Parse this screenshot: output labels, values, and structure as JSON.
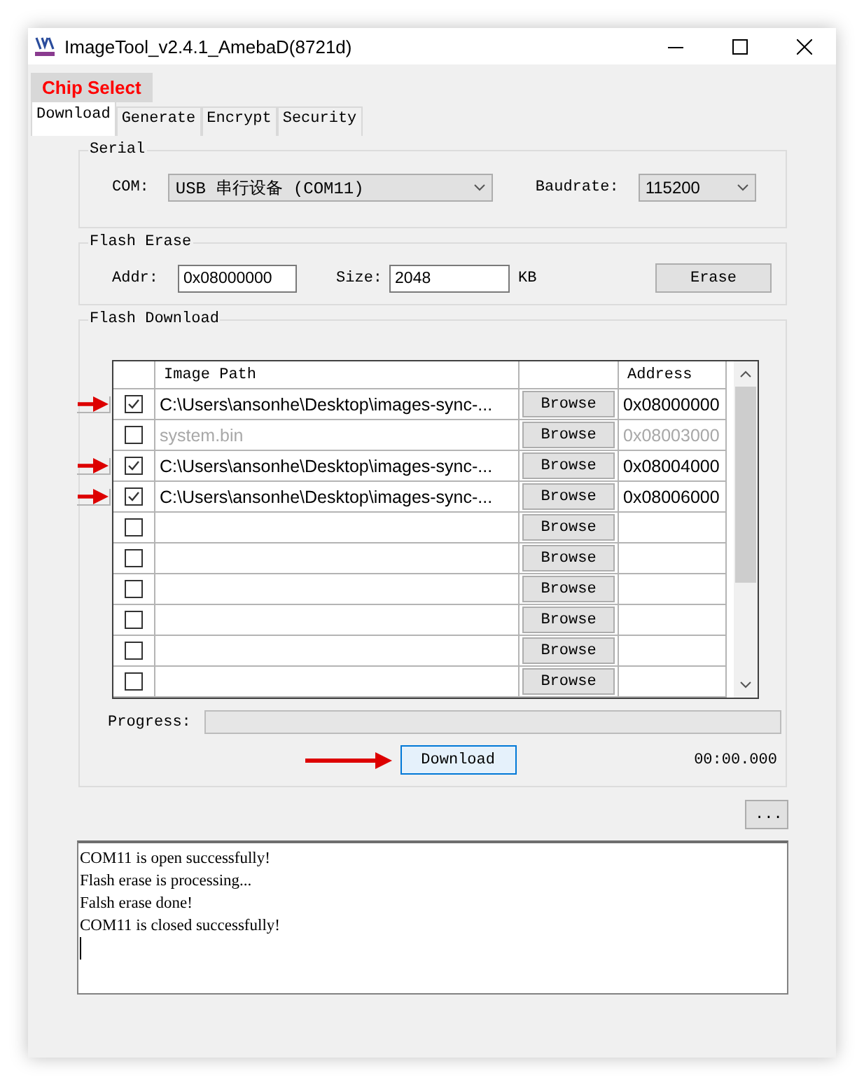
{
  "window": {
    "title": "ImageTool_v2.4.1_AmebaD(8721d)"
  },
  "chip_select": {
    "label": "Chip Select"
  },
  "tabs": [
    {
      "label": "Download",
      "selected": true
    },
    {
      "label": "Generate",
      "selected": false
    },
    {
      "label": "Encrypt",
      "selected": false
    },
    {
      "label": "Security",
      "selected": false
    }
  ],
  "serial": {
    "title": "Serial",
    "com_label": "COM:",
    "com_value": "USB 串行设备 (COM11)",
    "baud_label": "Baudrate:",
    "baud_value": "115200"
  },
  "flash_erase": {
    "title": "Flash Erase",
    "addr_label": "Addr:",
    "addr_value": "0x08000000",
    "size_label": "Size:",
    "size_value": "2048",
    "unit": "KB",
    "button": "Erase"
  },
  "flash_download": {
    "title": "Flash Download",
    "table": {
      "columns": [
        "Image Path",
        "Address"
      ],
      "rows": [
        {
          "checked": true,
          "disabled": false,
          "marked": true,
          "path": "C:\\Users\\ansonhe\\Desktop\\images-sync-...",
          "button": "Browse",
          "address": "0x08000000"
        },
        {
          "checked": false,
          "disabled": true,
          "marked": false,
          "path": "system.bin",
          "button": "Browse",
          "address": "0x08003000"
        },
        {
          "checked": true,
          "disabled": false,
          "marked": true,
          "path": "C:\\Users\\ansonhe\\Desktop\\images-sync-...",
          "button": "Browse",
          "address": "0x08004000"
        },
        {
          "checked": true,
          "disabled": false,
          "marked": true,
          "path": "C:\\Users\\ansonhe\\Desktop\\images-sync-...",
          "button": "Browse",
          "address": "0x08006000"
        },
        {
          "checked": false,
          "marked": false,
          "button": "Browse"
        },
        {
          "checked": false,
          "marked": false,
          "button": "Browse"
        },
        {
          "checked": false,
          "marked": false,
          "button": "Browse"
        },
        {
          "checked": false,
          "marked": false,
          "button": "Browse"
        },
        {
          "checked": false,
          "marked": false,
          "button": "Browse"
        },
        {
          "checked": false,
          "marked": false,
          "button": "Browse"
        }
      ]
    },
    "progress_label": "Progress:",
    "progress": {
      "level": 0
    },
    "download_button": {
      "label": "Download",
      "marked": true
    },
    "elapsed": "00:00.000"
  },
  "more_button": "...",
  "log": [
    "COM11 is open successfully!",
    "Flash erase is processing...",
    "Falsh erase done!",
    "COM11 is closed successfully!"
  ]
}
